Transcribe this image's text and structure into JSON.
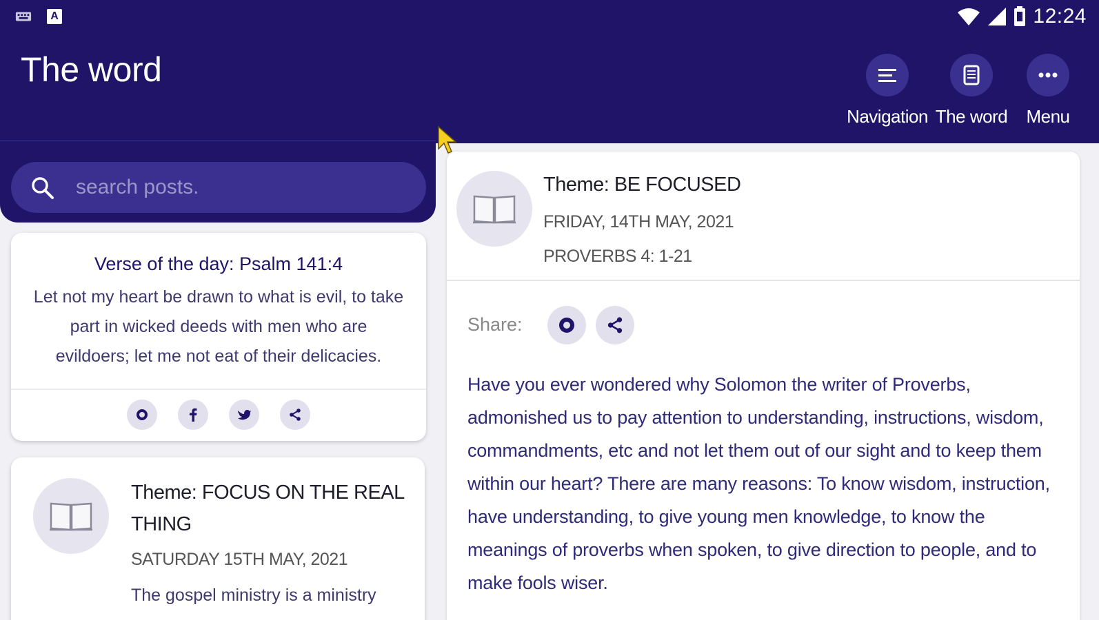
{
  "status_bar": {
    "time": "12:24",
    "left_icons": [
      "keyboard-icon",
      "a-icon"
    ],
    "right_icons": [
      "wifi-icon",
      "signal-icon",
      "battery-icon"
    ]
  },
  "app_bar": {
    "title": "The word",
    "actions": [
      {
        "icon": "list-icon",
        "label": "Navigation"
      },
      {
        "icon": "document-icon",
        "label": "The word"
      },
      {
        "icon": "more-icon",
        "label": "Menu"
      }
    ]
  },
  "search": {
    "placeholder": "search posts."
  },
  "verse_card": {
    "title": "Verse of the day: Psalm 141:4",
    "text": "Let not my heart be drawn to what is evil, to take part in wicked deeds with men who are evildoers; let me not eat of their delicacies.",
    "share_icons": [
      "whatsapp-icon",
      "facebook-icon",
      "twitter-icon",
      "share-icon"
    ]
  },
  "post_card": {
    "theme": "Theme: FOCUS ON THE REAL THING",
    "date": "SATURDAY 15TH MAY, 2021",
    "excerpt": "The gospel ministry is a ministry"
  },
  "detail": {
    "theme": "Theme:  BE FOCUSED",
    "date": "FRIDAY, 14TH MAY, 2021",
    "reference": "PROVERBS 4: 1-21",
    "share_label": "Share:",
    "body": "Have you ever wondered why Solomon the writer of Proverbs, admonished us to pay attention to understanding, instructions, wisdom, commandments, etc and not let them out of our sight and to keep them within our heart? There are many reasons: To know wisdom, instruction, have understanding, to give young men knowledge, to know the meanings of proverbs when spoken, to give direction to people, and to make fools wiser."
  },
  "colors": {
    "primary": "#1f1468",
    "primary_light": "#3b3090",
    "accent_soft": "#e3e0ee",
    "body_text": "#2f2a7a"
  }
}
